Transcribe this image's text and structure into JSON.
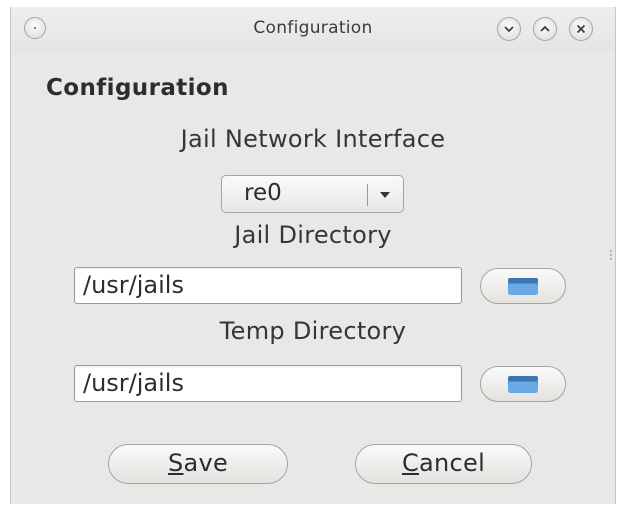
{
  "window": {
    "title": "Configuration"
  },
  "heading": "Configuration",
  "network": {
    "label": "Jail Network Interface",
    "selected": "re0"
  },
  "jail_directory": {
    "label": "Jail Directory",
    "value": "/usr/jails"
  },
  "temp_directory": {
    "label": "Temp Directory",
    "value": "/usr/jails"
  },
  "buttons": {
    "save_mnemonic": "S",
    "save_rest": "ave",
    "cancel_mnemonic": "C",
    "cancel_rest": "ancel"
  },
  "icons": {
    "window_menu": "window-menu-icon",
    "minimize": "chevron-down-icon",
    "maximize": "chevron-up-icon",
    "close": "close-icon",
    "dropdown": "dropdown-arrow-icon",
    "folder": "folder-icon"
  },
  "colors": {
    "window_bg": "#e9e8e6",
    "folder_icon": "#5b9bd5"
  }
}
